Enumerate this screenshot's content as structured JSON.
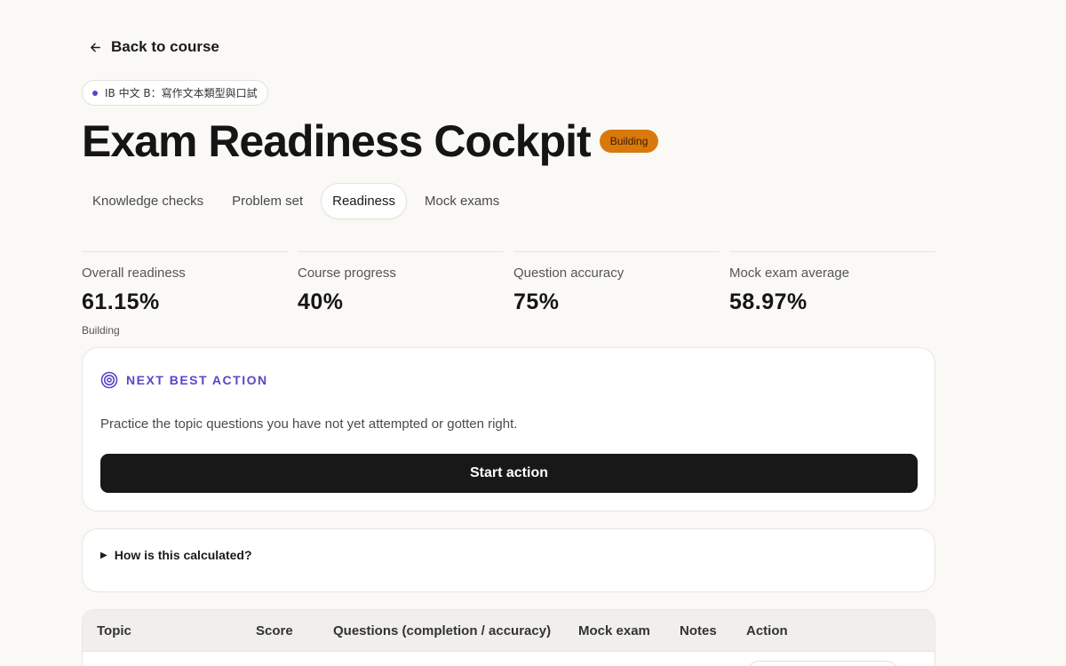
{
  "nav": {
    "back_label": "Back to course"
  },
  "course": {
    "chip_label": "IB 中文 B：寫作文本類型與口試"
  },
  "header": {
    "title": "Exam Readiness Cockpit",
    "status_badge": "Building"
  },
  "tabs": [
    {
      "label": "Knowledge checks",
      "active": false
    },
    {
      "label": "Problem set",
      "active": false
    },
    {
      "label": "Readiness",
      "active": true
    },
    {
      "label": "Mock exams",
      "active": false
    }
  ],
  "stats": [
    {
      "label": "Overall readiness",
      "value": "61.15%",
      "sub": "Building"
    },
    {
      "label": "Course progress",
      "value": "40%"
    },
    {
      "label": "Question accuracy",
      "value": "75%"
    },
    {
      "label": "Mock exam average",
      "value": "58.97%"
    }
  ],
  "next_action": {
    "title": "NEXT BEST ACTION",
    "description": "Practice the topic questions you have not yet attempted or gotten right.",
    "button_label": "Start action",
    "icon": "target-icon"
  },
  "calculation": {
    "summary": "How is this calculated?"
  },
  "table": {
    "columns": [
      "Topic",
      "Score",
      "Questions (completion / accuracy)",
      "Mock exam",
      "Notes",
      "Action"
    ]
  },
  "colors": {
    "accent": "#5b45c4",
    "badge_bg": "#d9790c",
    "button_bg": "#181818",
    "page_bg": "#faf9f6"
  }
}
